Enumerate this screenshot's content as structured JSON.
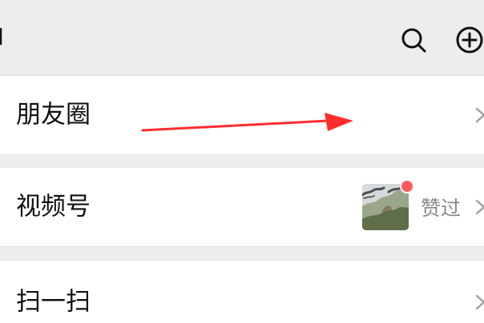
{
  "header": {
    "title_fragment": "l",
    "icons": {
      "search": "search-icon",
      "add": "plus-circle-icon"
    }
  },
  "rows": {
    "moments": {
      "label": "朋友圈",
      "chevron_icon": "chevron-right-icon"
    },
    "channels": {
      "label": "视频号",
      "status": "赞过",
      "chevron_icon": "chevron-right-icon",
      "thumbnail_icon": "landscape-thumbnail-icon"
    },
    "scan": {
      "label": "扫一扫",
      "chevron_icon": "chevron-right-icon"
    }
  },
  "colors": {
    "background": "#ededed",
    "card": "#ffffff",
    "text": "#111111",
    "muted_text": "#888888",
    "badge": "#ff5b5b",
    "annotation": "#ff2d2d"
  }
}
